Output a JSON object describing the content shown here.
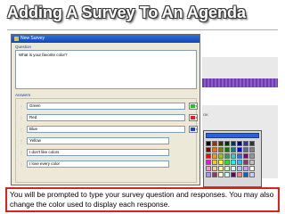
{
  "slide": {
    "title": "Adding A Survey To An Agenda"
  },
  "dialog": {
    "title": "New Survey",
    "question_label": "Question",
    "question_text": "What is your favorite color?",
    "answers_label": "Answers",
    "answers": [
      {
        "text": "Green",
        "color": "#22c02a"
      },
      {
        "text": "Red",
        "color": "#e02020"
      },
      {
        "text": "Blue",
        "color": "#2040d0"
      },
      {
        "text": "Yellow",
        "color": null
      },
      {
        "text": "I don't like colors",
        "color": null
      },
      {
        "text": "I love every color",
        "color": null
      }
    ]
  },
  "background_window": {
    "ok_label": "OK"
  },
  "palette": {
    "selected_color": "#2b5fe0",
    "colors": [
      "#000000",
      "#993300",
      "#333300",
      "#003300",
      "#003366",
      "#000080",
      "#333399",
      "#333333",
      "#800000",
      "#ff6600",
      "#808000",
      "#008000",
      "#008080",
      "#0000ff",
      "#666699",
      "#808080",
      "#ff0000",
      "#ff9900",
      "#99cc00",
      "#339966",
      "#33cccc",
      "#3366ff",
      "#800080",
      "#969696",
      "#ff00ff",
      "#ffcc00",
      "#ffff00",
      "#00ff00",
      "#00ffff",
      "#00ccff",
      "#993366",
      "#c0c0c0",
      "#ff99cc",
      "#ffcc99",
      "#ffff99",
      "#ccffcc",
      "#ccffff",
      "#99ccff",
      "#cc99ff",
      "#ffffff",
      "#9999ff",
      "#993366",
      "#ffffcc",
      "#ccffff",
      "#660066",
      "#ff8080",
      "#0066cc",
      "#ccccff"
    ]
  },
  "caption": "You will be prompted to type your survey question and responses.  You may also change the color used to display each response."
}
